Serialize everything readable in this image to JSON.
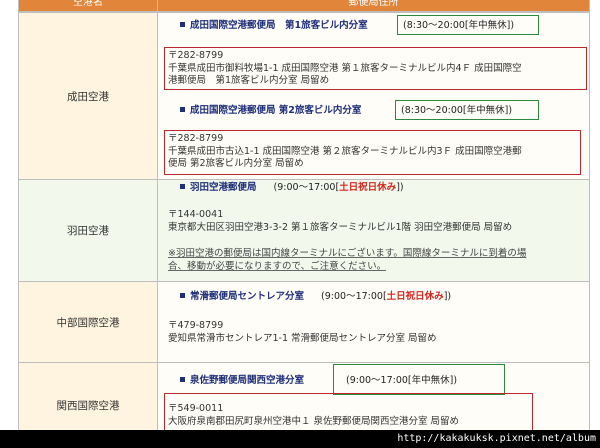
{
  "header": {
    "col1": "空港名",
    "col2": "郵便局住所"
  },
  "rows": [
    {
      "airport": "成田空港",
      "offices": [
        {
          "name": "成田国際空港郵便局　第1旅客ビル内分室",
          "hours": "(8:30～20:00[年中無休])",
          "postal": "〒282-8799",
          "addr1": "千葉県成田市御料牧場1-1 成田国際空港 第１旅客ターミナルビル内4Ｆ 成田国際空",
          "addr2": "港郵便局　第1旅客ビル内分室 局留め"
        },
        {
          "name": "成田国際空港郵便局 第2旅客ビル内分室",
          "hours": "(8:30～20:00[年中無休])",
          "postal": "〒282-8799",
          "addr1": "千葉県成田市古込1-1 成田国際空港 第２旅客ターミナルビル内3Ｆ 成田国際空港郵",
          "addr2": "便局 第2旅客ビル内分室 局留め"
        }
      ]
    },
    {
      "airport": "羽田空港",
      "office": {
        "name": "羽田空港郵便局",
        "hours_open": "(9:00～17:00[",
        "hours_closed": "土日祝日休み",
        "hours_close": "])",
        "postal": "〒144-0041",
        "addr1": "東京都大田区羽田空港3-3-2 第１旅客ターミナルビル1階 羽田空港郵便局 局留め",
        "note1": "※羽田空港の郵便局は国内線ターミナルにございます。国際線ターミナルに到着の場",
        "note2": "合、移動が必要になりますので、ご注意ください。"
      }
    },
    {
      "airport": "中部国際空港",
      "office": {
        "name": "常滑郵便局セントレア分室",
        "hours_open": "(9:00～17:00[",
        "hours_closed": "土日祝日休み",
        "hours_close": "])",
        "postal": "〒479-8799",
        "addr1": "愛知県常滑市セントレア1-1 常滑郵便局セントレア分室 局留め"
      }
    },
    {
      "airport": "関西国際空港",
      "office": {
        "name": "泉佐野郵便局関西空港分室",
        "hours": "(9:00～17:00[年中無休])",
        "postal": "〒549-0011",
        "addr1": "大阪府泉南郡田尻町泉州空港中１ 泉佐野郵便局関西空港分室 局留め"
      }
    }
  ],
  "footer": {
    "watermark": "http://kakakuksk.pixnet.net/album"
  }
}
